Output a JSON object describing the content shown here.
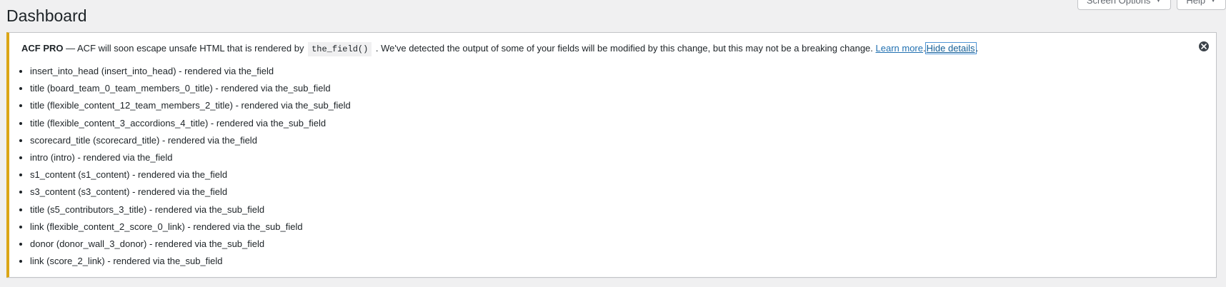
{
  "page": {
    "title": "Dashboard"
  },
  "screen_meta": {
    "screen_options_label": "Screen Options",
    "help_label": "Help",
    "caret": "▼"
  },
  "notice": {
    "prefix": "ACF PRO",
    "text_before_code": " — ACF will soon escape unsafe HTML that is rendered by ",
    "code": "the_field()",
    "text_after_code": " . We've detected the output of some of your fields will be modified by this change, but this may not be a breaking change. ",
    "learn_more": "Learn more",
    "separator": ".",
    "hide_details": "Hide details",
    "end": ".",
    "accent_color": "#dba617",
    "items": [
      "insert_into_head (insert_into_head) - rendered via the_field",
      "title (board_team_0_team_members_0_title) - rendered via the_sub_field",
      "title (flexible_content_12_team_members_2_title) - rendered via the_sub_field",
      "title (flexible_content_3_accordions_4_title) - rendered via the_sub_field",
      "scorecard_title (scorecard_title) - rendered via the_field",
      "intro (intro) - rendered via the_field",
      "s1_content (s1_content) - rendered via the_field",
      "s3_content (s3_content) - rendered via the_field",
      "title (s5_contributors_3_title) - rendered via the_sub_field",
      "link (flexible_content_2_score_0_link) - rendered via the_sub_field",
      "donor (donor_wall_3_donor) - rendered via the_sub_field",
      "link (score_2_link) - rendered via the_sub_field"
    ]
  },
  "icons": {
    "dismiss": "dismiss-icon",
    "caret": "caret-down-icon"
  }
}
